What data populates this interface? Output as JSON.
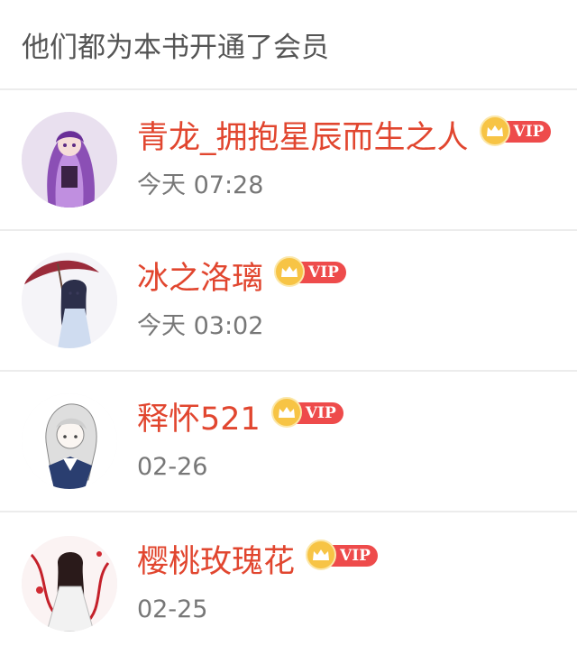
{
  "header": {
    "title": "他们都为本书开通了会员"
  },
  "members": [
    {
      "name": "青龙_拥抱星辰而生之人",
      "badge": "VIP",
      "time": "今天 07:28",
      "avatar_theme": "purple"
    },
    {
      "name": "冰之洛璃",
      "badge": "VIP",
      "time": "今天 03:02",
      "avatar_theme": "umbrella"
    },
    {
      "name": "释怀521",
      "badge": "VIP",
      "time": "02-26",
      "avatar_theme": "sketch"
    },
    {
      "name": "樱桃玫瑰花",
      "badge": "VIP",
      "time": "02-25",
      "avatar_theme": "red"
    }
  ],
  "colors": {
    "name": "#e1462f",
    "vip_pill": "#ee4b4b",
    "crown": "#f7c445"
  }
}
